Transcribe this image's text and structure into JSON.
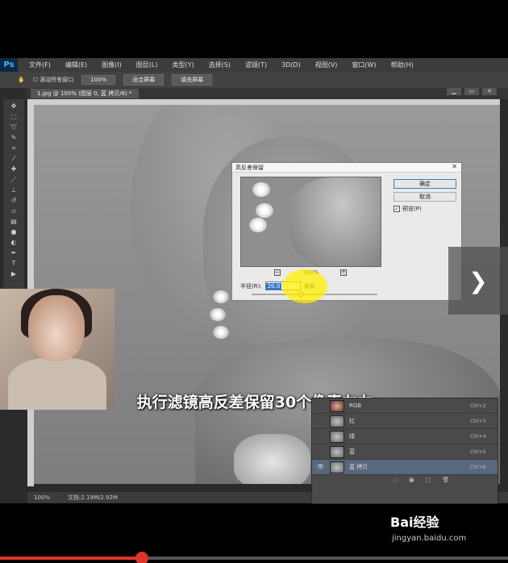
{
  "app": {
    "logo": "Ps"
  },
  "menu": [
    "文件(F)",
    "编辑(E)",
    "图像(I)",
    "图层(L)",
    "类型(Y)",
    "选择(S)",
    "滤镜(T)",
    "3D(D)",
    "视图(V)",
    "窗口(W)",
    "帮助(H)"
  ],
  "options": {
    "scroll_all": "滚动所有窗口",
    "zoom": "100%",
    "fit_screen": "适合屏幕",
    "fill_screen": "填充屏幕"
  },
  "document": {
    "tab": "1.jpg @ 100% (图层 0, 蓝 拷贝/8) *"
  },
  "status": {
    "zoom": "100%",
    "doc_size": "文档:2.19M/2.92M"
  },
  "dialog": {
    "title": "高反差保留",
    "ok": "确定",
    "cancel": "取消",
    "preview": "预览(P)",
    "zoom": "100%",
    "radius_label": "半径(R):",
    "radius_value": "20.0",
    "unit": "像素"
  },
  "caption": "执行滤镜高反差保留30个像素左右",
  "nav": {
    "next_icon": "chevron-right-icon"
  },
  "layers": [
    {
      "name": "RGB",
      "key": "Ctrl+2"
    },
    {
      "name": "红",
      "key": "Ctrl+3"
    },
    {
      "name": "绿",
      "key": "Ctrl+4"
    },
    {
      "name": "蓝",
      "key": "Ctrl+5"
    },
    {
      "name": "蓝 拷贝",
      "key": "Ctrl+6"
    }
  ],
  "watermark": {
    "brand": "Bai经验",
    "url": "jingyan.baidu.com"
  },
  "video": {
    "progress": 0.28
  }
}
